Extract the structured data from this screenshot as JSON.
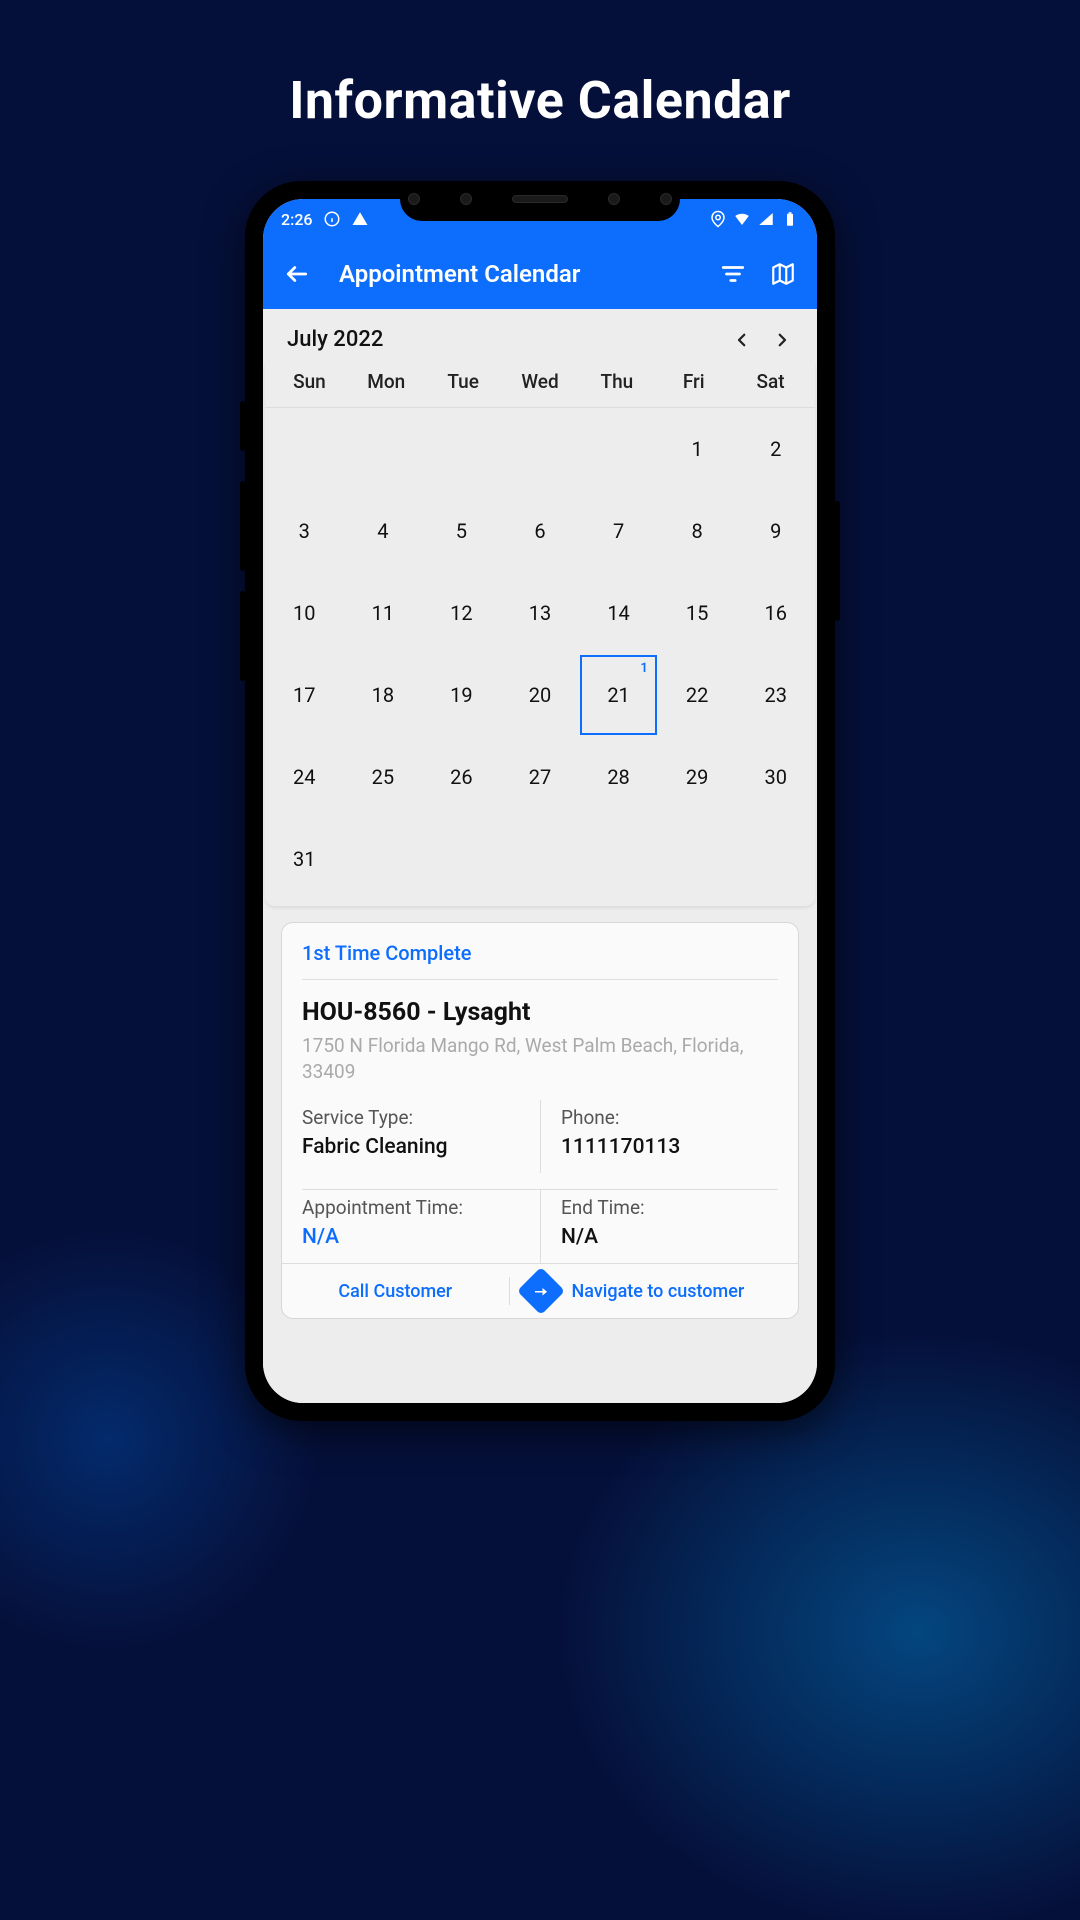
{
  "headline": "Informative Calendar",
  "status": {
    "time": "2:26"
  },
  "appbar": {
    "title": "Appointment Calendar"
  },
  "calendar": {
    "month_label": "July 2022",
    "dow": [
      "Sun",
      "Mon",
      "Tue",
      "Wed",
      "Thu",
      "Fri",
      "Sat"
    ],
    "weeks": [
      [
        null,
        null,
        null,
        null,
        null,
        {
          "d": 1
        },
        {
          "d": 2
        }
      ],
      [
        {
          "d": 3
        },
        {
          "d": 4
        },
        {
          "d": 5
        },
        {
          "d": 6
        },
        {
          "d": 7
        },
        {
          "d": 8
        },
        {
          "d": 9
        }
      ],
      [
        {
          "d": 10
        },
        {
          "d": 11
        },
        {
          "d": 12
        },
        {
          "d": 13
        },
        {
          "d": 14
        },
        {
          "d": 15
        },
        {
          "d": 16
        }
      ],
      [
        {
          "d": 17
        },
        {
          "d": 18
        },
        {
          "d": 19
        },
        {
          "d": 20
        },
        {
          "d": 21,
          "selected": true,
          "badge": 1
        },
        {
          "d": 22
        },
        {
          "d": 23
        }
      ],
      [
        {
          "d": 24
        },
        {
          "d": 25
        },
        {
          "d": 26
        },
        {
          "d": 27
        },
        {
          "d": 28
        },
        {
          "d": 29
        },
        {
          "d": 30
        }
      ],
      [
        {
          "d": 31
        },
        null,
        null,
        null,
        null,
        null,
        null
      ]
    ]
  },
  "card": {
    "status": "1st Time Complete",
    "title": "HOU-8560 - Lysaght",
    "address": "1750 N Florida Mango Rd, West Palm Beach, Florida, 33409",
    "service_label": "Service Type:",
    "service_value": "Fabric Cleaning",
    "phone_label": "Phone:",
    "phone_value": "1111170113",
    "appt_label": "Appointment Time:",
    "appt_value": "N/A",
    "end_label": "End Time:",
    "end_value": "N/A",
    "call_action": "Call Customer",
    "nav_action": "Navigate to customer"
  }
}
